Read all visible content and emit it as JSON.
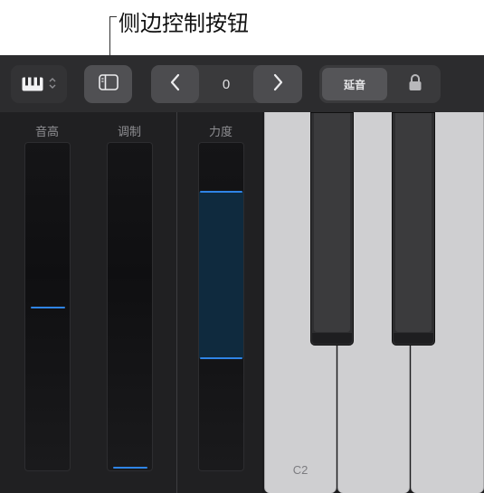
{
  "callout": {
    "text": "侧边控制按钮"
  },
  "toolbar": {
    "keyboard_picker_icon": "piano-keys-icon",
    "sidebar_icon": "sidebar-icon",
    "octave_value": "0",
    "sustain_label": "延音",
    "lock_icon": "lock-icon"
  },
  "controls": {
    "pitch_label": "音高",
    "modulation_label": "调制",
    "velocity_label": "力度",
    "pitch_level": 0.5,
    "modulation_level": 0.0,
    "velocity_range": [
      0.34,
      0.86
    ]
  },
  "keyboard": {
    "c_label": "C2"
  },
  "colors": {
    "accent": "#2f84e6",
    "background": "#2a2a2c",
    "white_key": "#cfcfd1"
  }
}
